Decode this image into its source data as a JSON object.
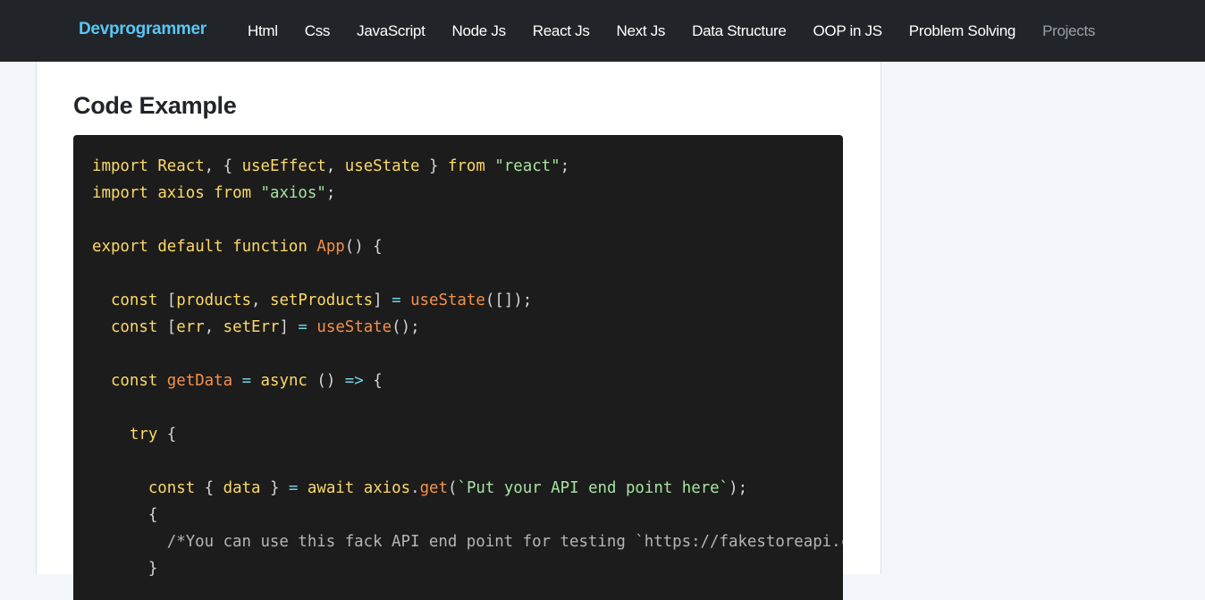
{
  "brand": "Devprogrammer",
  "nav": [
    "Html",
    "Css",
    "JavaScript",
    "Node Js",
    "React Js",
    "Next Js",
    "Data Structure",
    "OOP in JS",
    "Problem Solving",
    "Projects"
  ],
  "section_title": "Code Example",
  "code_lines": [
    [
      [
        "k",
        "import"
      ],
      [
        "w",
        " "
      ],
      [
        "k",
        "React"
      ],
      [
        "p",
        ", { "
      ],
      [
        "k",
        "useEffect"
      ],
      [
        "p",
        ", "
      ],
      [
        "k",
        "useState"
      ],
      [
        "p",
        " } "
      ],
      [
        "k",
        "from"
      ],
      [
        "w",
        " "
      ],
      [
        "s",
        "\"react\""
      ],
      [
        "p",
        ";"
      ]
    ],
    [
      [
        "k",
        "import"
      ],
      [
        "w",
        " "
      ],
      [
        "k",
        "axios"
      ],
      [
        "w",
        " "
      ],
      [
        "k",
        "from"
      ],
      [
        "w",
        " "
      ],
      [
        "s",
        "\"axios\""
      ],
      [
        "p",
        ";"
      ]
    ],
    [],
    [
      [
        "k",
        "export"
      ],
      [
        "w",
        " "
      ],
      [
        "k",
        "default"
      ],
      [
        "w",
        " "
      ],
      [
        "k",
        "function"
      ],
      [
        "w",
        " "
      ],
      [
        "f",
        "App"
      ],
      [
        "p",
        "() {"
      ]
    ],
    [],
    [
      [
        "w",
        "  "
      ],
      [
        "k",
        "const"
      ],
      [
        "p",
        " ["
      ],
      [
        "k",
        "products"
      ],
      [
        "p",
        ", "
      ],
      [
        "k",
        "setProducts"
      ],
      [
        "p",
        "] "
      ],
      [
        "o",
        "="
      ],
      [
        "w",
        " "
      ],
      [
        "f",
        "useState"
      ],
      [
        "p",
        "([]);"
      ]
    ],
    [
      [
        "w",
        "  "
      ],
      [
        "k",
        "const"
      ],
      [
        "p",
        " ["
      ],
      [
        "k",
        "err"
      ],
      [
        "p",
        ", "
      ],
      [
        "k",
        "setErr"
      ],
      [
        "p",
        "] "
      ],
      [
        "o",
        "="
      ],
      [
        "w",
        " "
      ],
      [
        "f",
        "useState"
      ],
      [
        "p",
        "();"
      ]
    ],
    [],
    [
      [
        "w",
        "  "
      ],
      [
        "k",
        "const"
      ],
      [
        "w",
        " "
      ],
      [
        "f",
        "getData"
      ],
      [
        "w",
        " "
      ],
      [
        "o",
        "="
      ],
      [
        "w",
        " "
      ],
      [
        "k",
        "async"
      ],
      [
        "p",
        " () "
      ],
      [
        "o",
        "=>"
      ],
      [
        "p",
        " {"
      ]
    ],
    [],
    [
      [
        "w",
        "    "
      ],
      [
        "k",
        "try"
      ],
      [
        "p",
        " {"
      ]
    ],
    [],
    [
      [
        "w",
        "      "
      ],
      [
        "k",
        "const"
      ],
      [
        "p",
        " { "
      ],
      [
        "k",
        "data"
      ],
      [
        "p",
        " } "
      ],
      [
        "o",
        "="
      ],
      [
        "w",
        " "
      ],
      [
        "k",
        "await"
      ],
      [
        "w",
        " "
      ],
      [
        "k",
        "axios"
      ],
      [
        "p",
        "."
      ],
      [
        "f",
        "get"
      ],
      [
        "p",
        "("
      ],
      [
        "s",
        "`Put your API end point here`"
      ],
      [
        "p",
        ");"
      ]
    ],
    [
      [
        "w",
        "      "
      ],
      [
        "p",
        "{"
      ]
    ],
    [
      [
        "w",
        "        "
      ],
      [
        "c",
        "/*You can use this fack API end point for testing `https://fakestoreapi.com/products`*/"
      ]
    ],
    [
      [
        "w",
        "      "
      ],
      [
        "p",
        "}"
      ]
    ]
  ]
}
